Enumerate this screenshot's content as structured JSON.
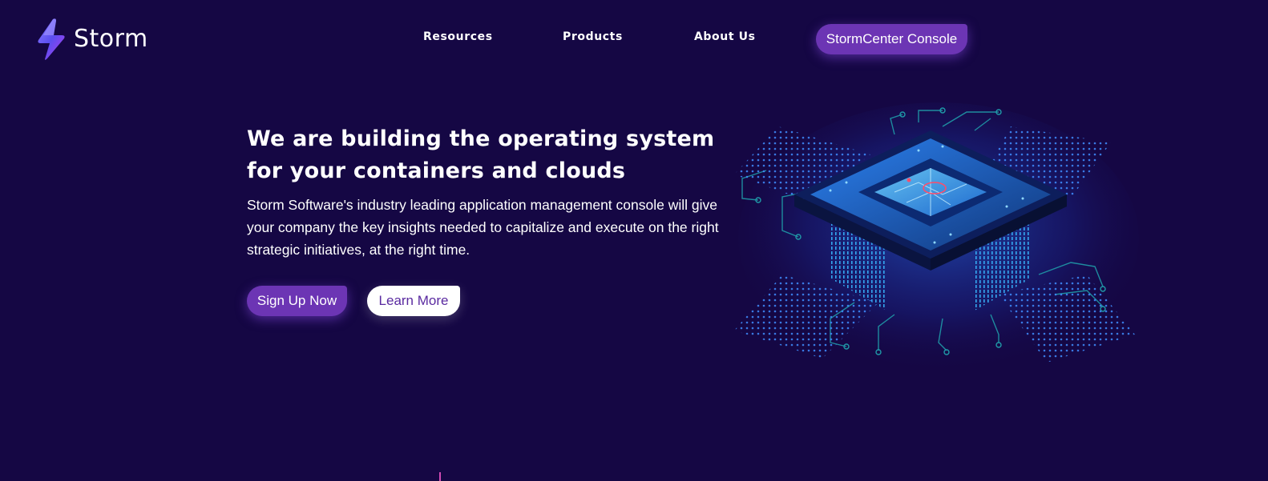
{
  "brand": {
    "name": "Storm",
    "logo_icon": "lightning-bolt-icon"
  },
  "nav": {
    "items": [
      {
        "label": "Resources"
      },
      {
        "label": "Products"
      },
      {
        "label": "About Us"
      }
    ],
    "console_label": "StormCenter Console"
  },
  "hero": {
    "headline": "We are building the operating system for your containers and clouds",
    "description": "Storm Software's industry leading application management console will give your company the key insights needed to capitalize and execute on the right strategic initiatives, at the right time.",
    "primary_cta": "Sign Up Now",
    "secondary_cta": "Learn More",
    "illustration": "isometric-cpu-chip-illustration"
  },
  "colors": {
    "background": "#150744",
    "accent": "#6c35b4",
    "accent_text": "#5a2aa0",
    "chip_glow": "#1e6cff",
    "circuit_line": "#1f9aa8"
  }
}
